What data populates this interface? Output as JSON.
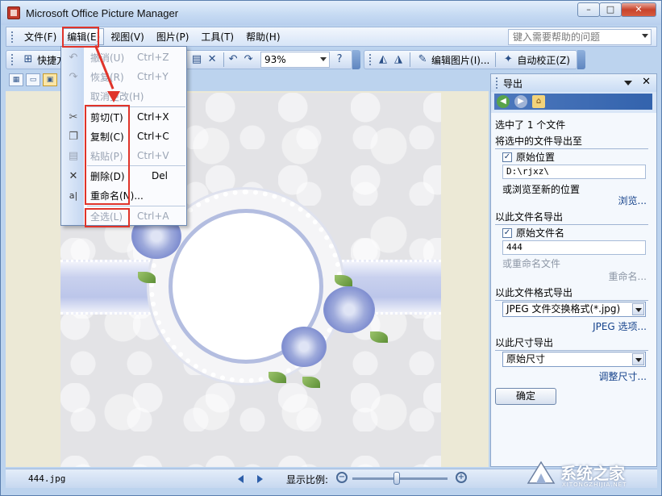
{
  "window": {
    "title": "Microsoft Office Picture Manager",
    "minimize_label": "0",
    "maximize_label": "□",
    "close_label": "✕"
  },
  "menubar": {
    "items": [
      {
        "label": "文件(F)"
      },
      {
        "label": "编辑(E)"
      },
      {
        "label": "视图(V)"
      },
      {
        "label": "图片(P)"
      },
      {
        "label": "工具(T)"
      },
      {
        "label": "帮助(H)"
      }
    ],
    "help_placeholder": "键入需要帮助的问题"
  },
  "toolbar": {
    "shortcut_label": "快捷方",
    "zoom_value": "93%",
    "edit_picture_label": "编辑图片(I)...",
    "auto_correct_label": "自动校正(Z)"
  },
  "edit_menu": {
    "items": [
      {
        "label": "撤消(U)",
        "shortcut": "Ctrl+Z",
        "enabled": false,
        "icon": "undo-icon"
      },
      {
        "label": "恢复(R)",
        "shortcut": "Ctrl+Y",
        "enabled": false,
        "icon": "redo-icon"
      },
      {
        "label": "取消更改(H)",
        "shortcut": "",
        "enabled": false,
        "icon": ""
      },
      {
        "label": "剪切(T)",
        "shortcut": "Ctrl+X",
        "enabled": true,
        "icon": "scissors-icon"
      },
      {
        "label": "复制(C)",
        "shortcut": "Ctrl+C",
        "enabled": true,
        "icon": "copy-icon"
      },
      {
        "label": "粘贴(P)",
        "shortcut": "Ctrl+V",
        "enabled": false,
        "icon": "paste-icon"
      },
      {
        "label": "删除(D)",
        "shortcut": "Del",
        "enabled": true,
        "icon": "delete-icon"
      },
      {
        "label": "重命名(N)...",
        "shortcut": "",
        "enabled": true,
        "icon": "rename-icon"
      },
      {
        "label": "全选(L)",
        "shortcut": "Ctrl+A",
        "enabled": false,
        "icon": ""
      }
    ]
  },
  "task_pane": {
    "title": "导出",
    "selected_info": "选中了 1 个文件",
    "export_to_heading": "将选中的文件导出至",
    "original_location_label": "原始位置",
    "original_location_checked": true,
    "path_value": "D:\\rjxz\\",
    "browse_new_text": "或浏览至新的位置",
    "browse_link": "浏览...",
    "filename_heading": "以此文件名导出",
    "original_filename_label": "原始文件名",
    "original_filename_checked": true,
    "filename_value": "444",
    "rename_text": "或重命名文件",
    "rename_link": "重命名...",
    "format_heading": "以此文件格式导出",
    "format_value": "JPEG 文件交换格式(*.jpg)",
    "jpeg_options_link": "JPEG 选项...",
    "size_heading": "以此尺寸导出",
    "size_value": "原始尺寸",
    "resize_link": "调整尺寸...",
    "ok_label": "确定"
  },
  "statusbar": {
    "filename": "444.jpg",
    "zoom_label": "显示比例:"
  },
  "watermark": {
    "text": "系统之家",
    "sub": "XITONGZHIJIA.NET"
  },
  "colors": {
    "annotation_red": "#e0342a",
    "title_bar": "#c7dbf3",
    "link_blue": "#15428b"
  }
}
